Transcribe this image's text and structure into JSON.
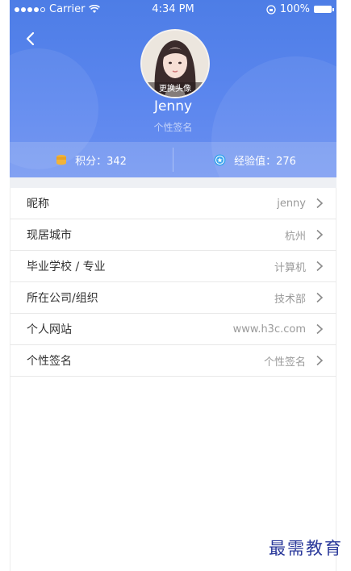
{
  "status_bar": {
    "carrier": "Carrier",
    "time": "4:34 PM",
    "battery": "100%"
  },
  "profile": {
    "avatar_caption": "更换头像",
    "name": "Jenny",
    "signature": "个性签名"
  },
  "stats": {
    "points": "积分：342",
    "experience": "经验值：276"
  },
  "rows": [
    {
      "label": "昵称",
      "value": "jenny"
    },
    {
      "label": "现居城市",
      "value": "杭州"
    },
    {
      "label": "毕业学校 / 专业",
      "value": "计算机"
    },
    {
      "label": "所在公司/组织",
      "value": "技术部"
    },
    {
      "label": "个人网站",
      "value": "www.h3c.com"
    },
    {
      "label": "个性签名",
      "value": "个性签名"
    }
  ],
  "watermark": "最需教育",
  "colors": {
    "header": "#4d7de6",
    "coin": "#f2b33a",
    "badge": "#37a3ee"
  }
}
